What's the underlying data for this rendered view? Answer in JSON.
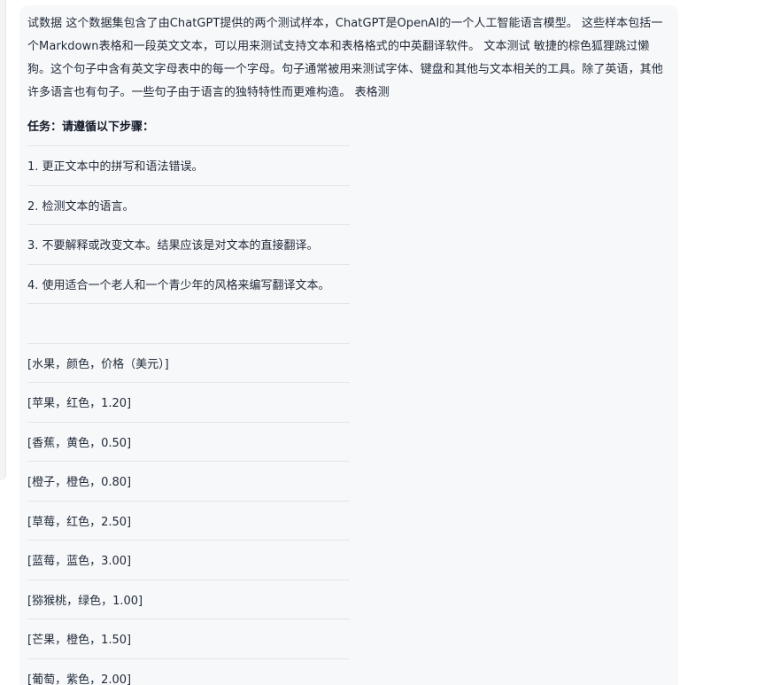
{
  "message": {
    "intro": "试数据 这个数据集包含了由ChatGPT提供的两个测试样本，ChatGPT是OpenAI的一个人工智能语言模型。 这些样本包括一个Markdown表格和一段英文文本，可以用来测试支持文本和表格格式的中英翻译软件。 文本测试 敏捷的棕色狐狸跳过懒狗。这个句子中含有英文字母表中的每一个字母。句子通常被用来测试字体、键盘和其他与文本相关的工具。除了英语，其他许多语言也有句子。一些句子由于语言的独特特性而更难构造。 表格测",
    "task_heading": "任务：请遵循以下步骤：",
    "steps": [
      "1. 更正文本中的拼写和语法错误。",
      "2. 检测文本的语言。",
      "3. 不要解释或改变文本。结果应该是对文本的直接翻译。",
      "4. 使用适合一个老人和一个青少年的风格来编写翻译文本。"
    ],
    "blank_row": "",
    "table_rows": [
      "[水果，颜色，价格（美元）]",
      "[苹果，红色，1.20]",
      "[香蕉，黄色，0.50]",
      "[橙子，橙色，0.80]",
      "[草莓，红色，2.50]",
      "[蓝莓，蓝色，3.00]",
      "[猕猴桃，绿色，1.00]",
      "[芒果，橙色，1.50]",
      "[葡萄，紫色，2.00]"
    ]
  }
}
